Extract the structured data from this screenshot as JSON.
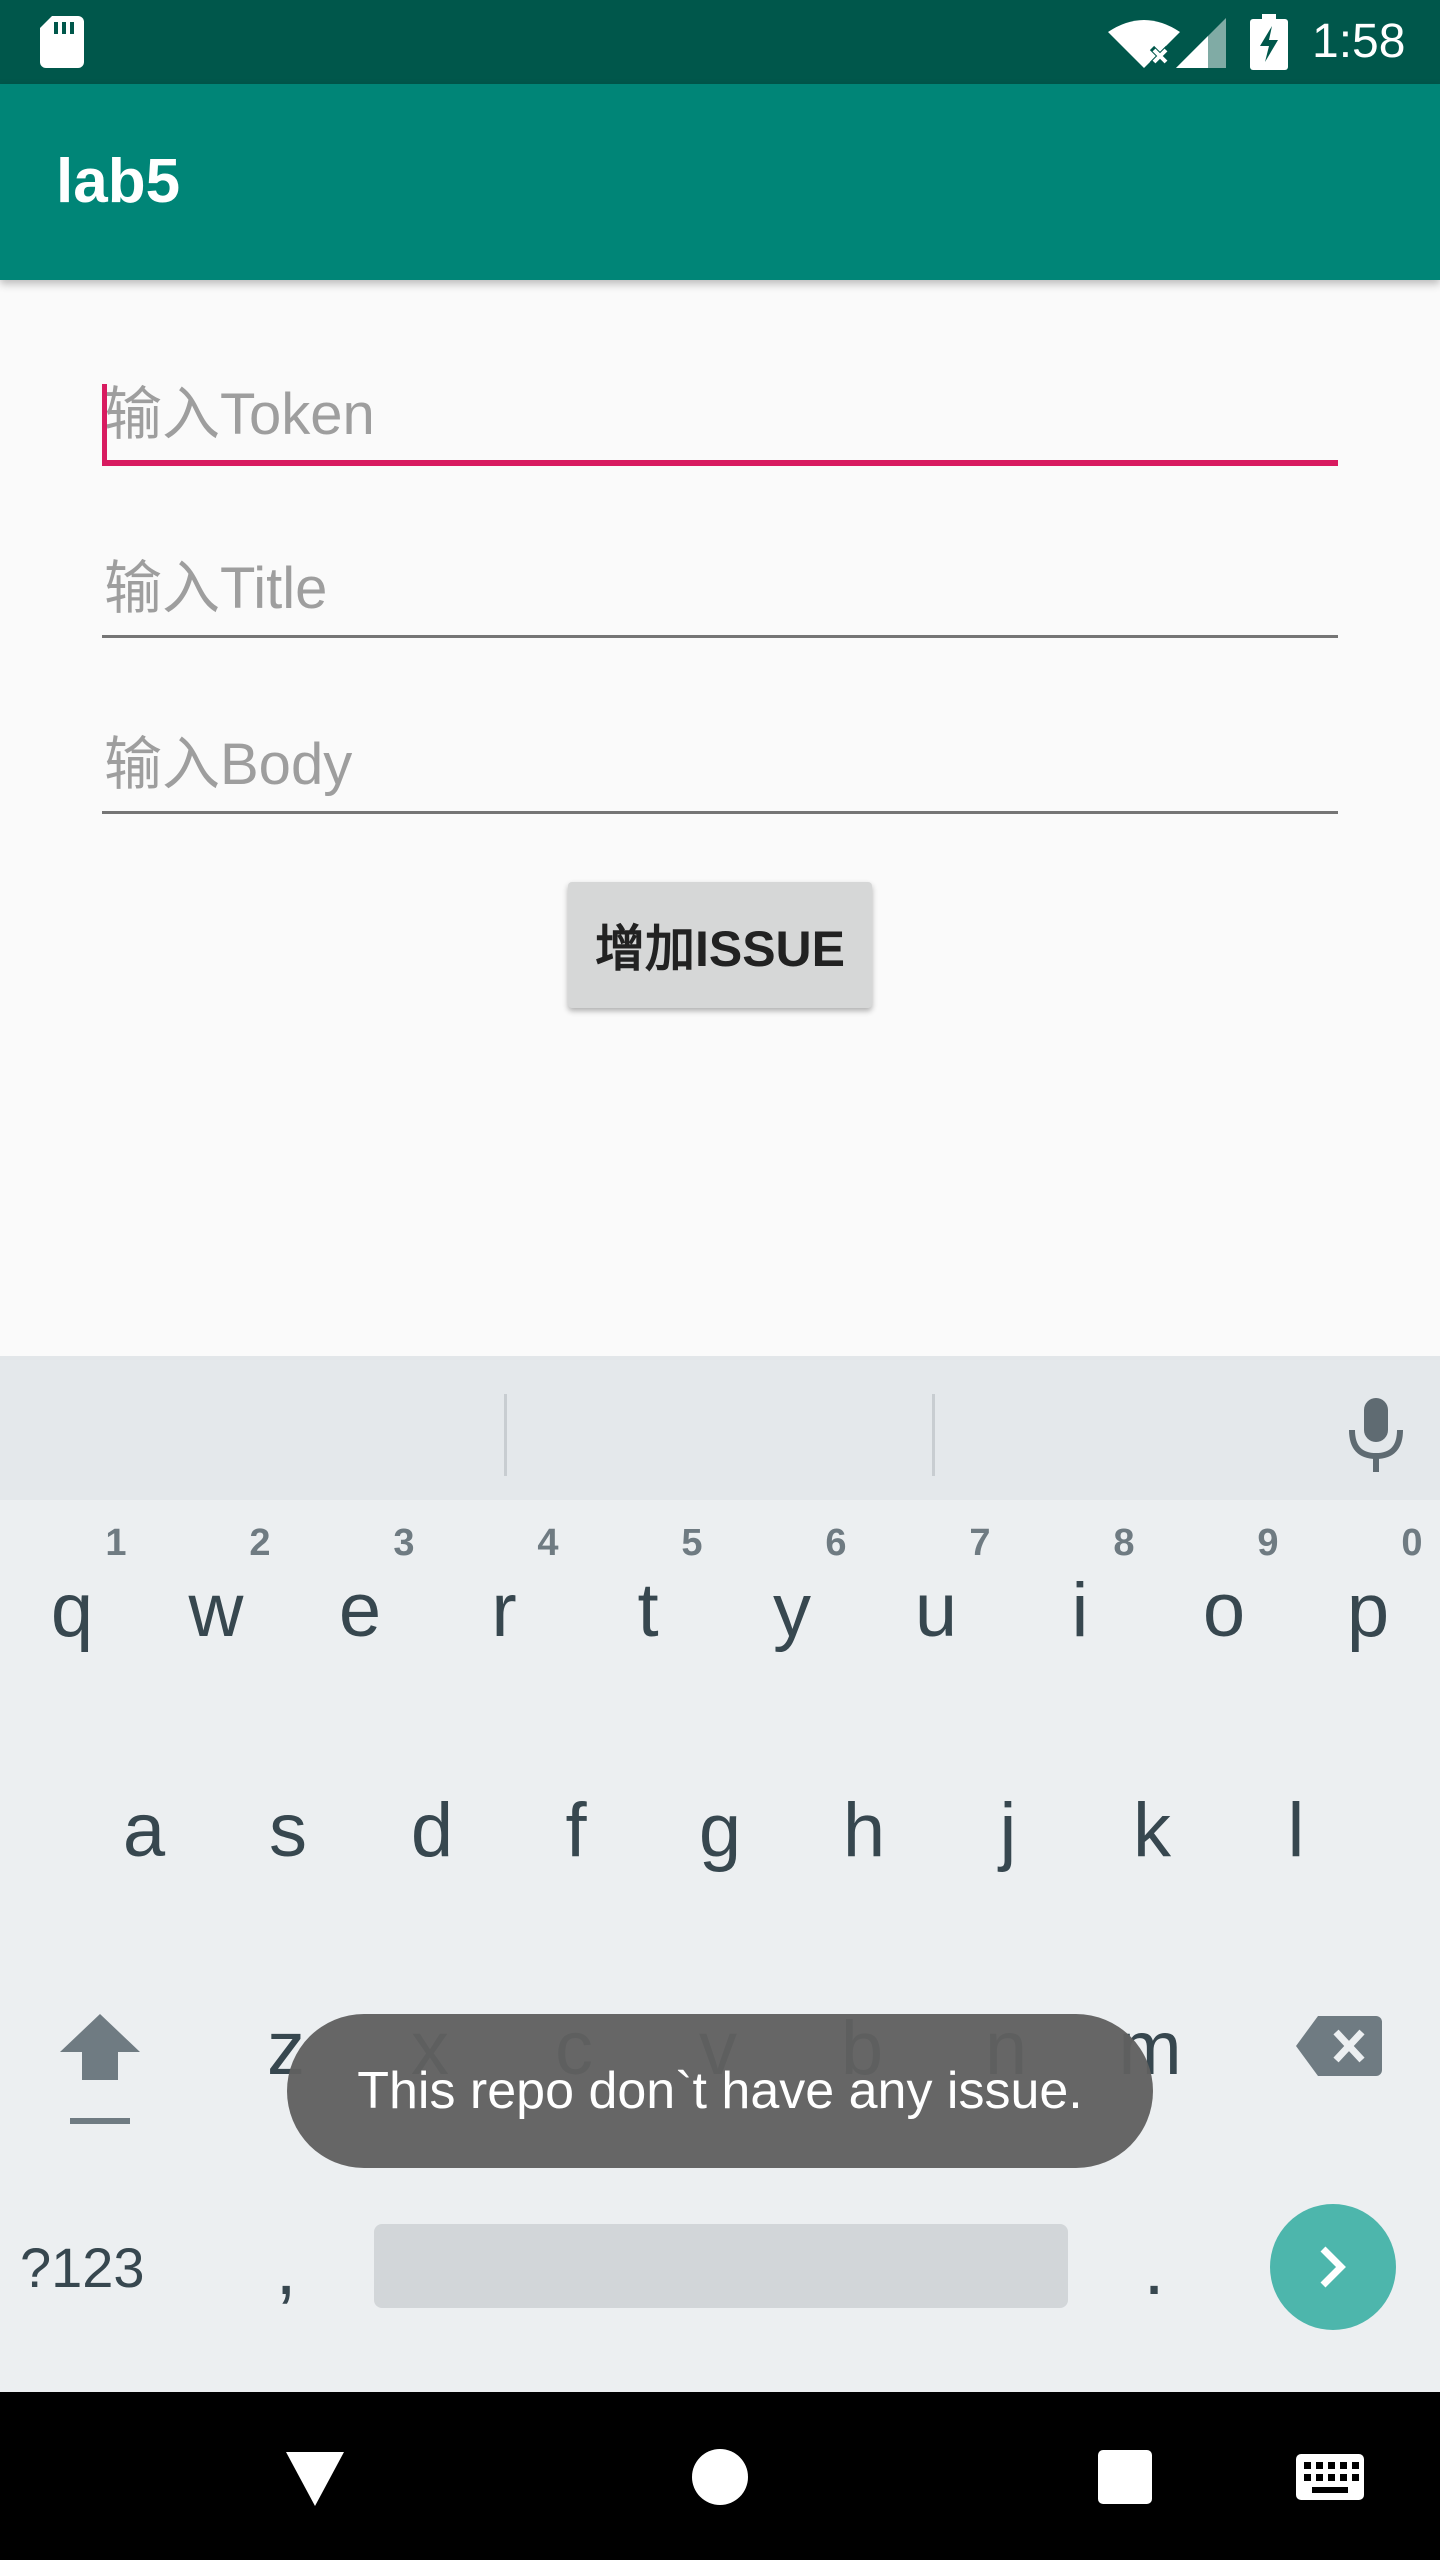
{
  "status_bar": {
    "time": "1:58",
    "icons": [
      "sd-card-icon",
      "wifi-off-icon",
      "cell-signal-icon",
      "battery-charging-icon"
    ]
  },
  "app_bar": {
    "title": "lab5"
  },
  "form": {
    "token_placeholder": "输入Token",
    "title_placeholder": "输入Title",
    "body_placeholder": "输入Body",
    "add_issue_label": "增加ISSUE"
  },
  "colors": {
    "status_bar": "#00574b",
    "app_bar": "#008577",
    "accent": "#d81b60",
    "button": "#d6d7d7",
    "enter_key": "#4db6ac"
  },
  "keyboard": {
    "row1": [
      {
        "key": "q",
        "hint": "1"
      },
      {
        "key": "w",
        "hint": "2"
      },
      {
        "key": "e",
        "hint": "3"
      },
      {
        "key": "r",
        "hint": "4"
      },
      {
        "key": "t",
        "hint": "5"
      },
      {
        "key": "y",
        "hint": "6"
      },
      {
        "key": "u",
        "hint": "7"
      },
      {
        "key": "i",
        "hint": "8"
      },
      {
        "key": "o",
        "hint": "9"
      },
      {
        "key": "p",
        "hint": "0"
      }
    ],
    "row2": [
      "a",
      "s",
      "d",
      "f",
      "g",
      "h",
      "j",
      "k",
      "l"
    ],
    "row3": [
      "z",
      "x",
      "c",
      "v",
      "b",
      "n",
      "m"
    ],
    "symbols_label": "?123",
    "comma": ",",
    "period": ".",
    "icons": [
      "mic-icon",
      "shift-icon",
      "backspace-icon",
      "enter-arrow-icon"
    ]
  },
  "toast": {
    "message": "This repo don`t have any issue."
  },
  "nav_bar": {
    "icons": [
      "back-icon",
      "home-icon",
      "recents-icon",
      "keyboard-switch-icon"
    ]
  }
}
